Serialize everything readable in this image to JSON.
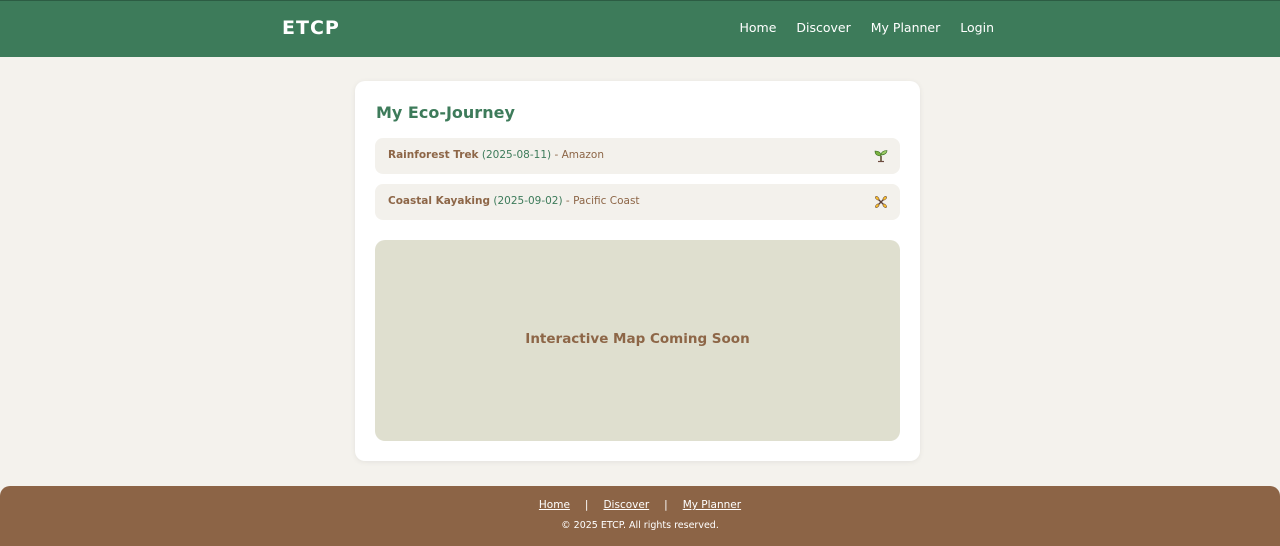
{
  "header": {
    "brand": "ETCP",
    "nav": [
      {
        "label": "Home"
      },
      {
        "label": "Discover"
      },
      {
        "label": "My Planner"
      },
      {
        "label": "Login"
      }
    ]
  },
  "card": {
    "title": "My Eco-Journey",
    "trips": [
      {
        "name": "Rainforest Trek",
        "date": "(2025-08-11)",
        "sep": " - ",
        "location": "Amazon",
        "icon": "seedling-icon"
      },
      {
        "name": "Coastal Kayaking",
        "date": "(2025-09-02)",
        "sep": " - ",
        "location": "Pacific Coast",
        "icon": "paddle-icon"
      }
    ],
    "map": {
      "label": "Interactive Map Coming Soon"
    }
  },
  "footer": {
    "links": [
      {
        "label": "Home"
      },
      {
        "label": "Discover"
      },
      {
        "label": "My Planner"
      }
    ],
    "separator": "|",
    "copyright": "© 2025 ETCP. All rights reserved."
  },
  "colors": {
    "primary_green": "#3d7b5a",
    "brown": "#8c6446",
    "background": "#f4f2ed",
    "map_bg": "#dfdfcf"
  }
}
